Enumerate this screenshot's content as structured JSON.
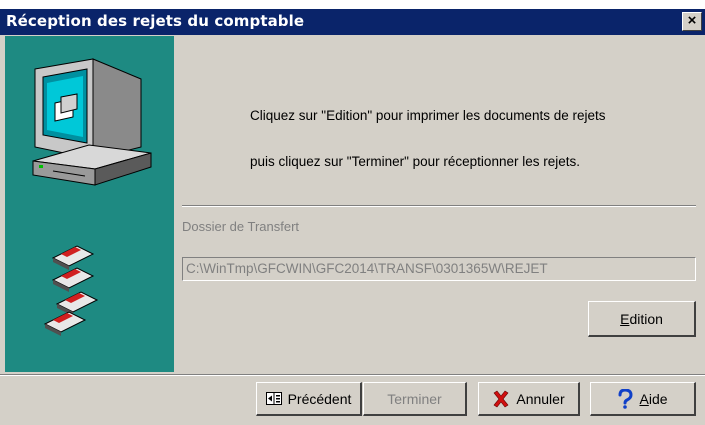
{
  "window": {
    "title": "Réception des rejets du comptable",
    "close_label": "×"
  },
  "content": {
    "line1": "Cliquez sur \"Edition\" pour imprimer les documents de rejets",
    "line2": "puis cliquez sur \"Terminer\" pour réceptionner les rejets.",
    "folder_label": "Dossier de Transfert",
    "folder_path": "C:\\WinTmp\\GFCWIN\\GFC2014\\TRANSF\\0301365W\\REJET"
  },
  "buttons": {
    "edition": {
      "first": "E",
      "rest": "dition"
    },
    "precedent": "Précédent",
    "terminer": "Terminer",
    "annuler": "Annuler",
    "aide": {
      "first": "A",
      "rest": "ide"
    }
  },
  "icons": [
    "computer-icon",
    "floppy-disk-icon",
    "previous-icon",
    "cancel-x-icon",
    "help-question-icon"
  ],
  "colors": {
    "titlebar": "#0a246a",
    "sidepanel": "#1e8a82",
    "face": "#d4d0c8"
  }
}
